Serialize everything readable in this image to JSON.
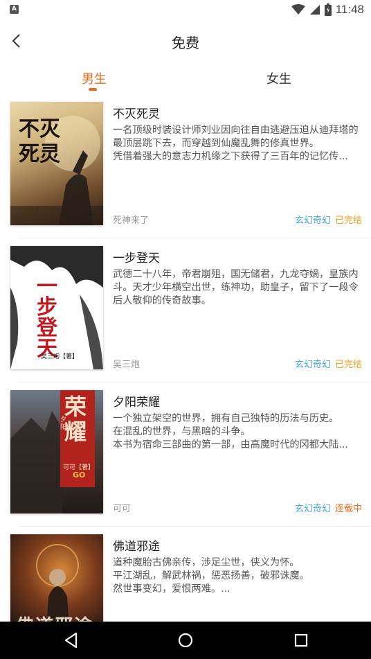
{
  "status_bar": {
    "notification_icon": "A",
    "time": "11:48",
    "icons": [
      "wifi-icon",
      "signal-icon",
      "battery-icon"
    ]
  },
  "header": {
    "title": "免费",
    "back_icon": "chevron-left-icon"
  },
  "tabs": [
    {
      "label": "男生",
      "active": true
    },
    {
      "label": "女生",
      "active": false
    }
  ],
  "colors": {
    "accent": "#f06a1b",
    "genre": "#4aa8e0",
    "completed": "#f0a020",
    "ongoing": "#f06a1b"
  },
  "books": [
    {
      "title": "不灭死灵",
      "description": "一名顶级时装设计师刘业因向往自由逃避压迫从迪拜塔的最顶层跳下去，而穿越到仙魔乱舞的修真世界。\n凭借着强大的意志力机缘之下获得了三百年的记忆传...",
      "author": "死神来了",
      "genre": "玄幻奇幻",
      "status": "已完结",
      "cover_text": "不灭死灵"
    },
    {
      "title": "一步登天",
      "description": "武德二十八年，帝君崩殂，国无储君，九龙夺嫡，皇族内斗。天才少年横空出世，练神功，助皇子，留下了一段令后人敬仰的传奇故事。",
      "author": "吴三炮",
      "genre": "玄幻奇幻",
      "status": "已完结",
      "cover_text": "一步登天",
      "cover_sub": "吴三炮【著】"
    },
    {
      "title": "夕阳荣耀",
      "description": "一个独立架空的世界，拥有自己独特的历法与历史。\n在混乱的世界，与黑暗的斗争。\n本书为宿命三部曲的第一部，由高魔时代的冈都大陆...",
      "author": "可可",
      "genre": "玄幻奇幻",
      "status": "连载中",
      "cover_text": "荣耀",
      "cover_side": "夕阳",
      "cover_sub": "可可【著】",
      "cover_go": "GO"
    },
    {
      "title": "佛道邪途",
      "description": "道种魔胎古佛亲传，涉足尘世，侠义为怀。\n平江湖乱，解武林祸，惩恶扬善，破邪诛魔。\n然世事变幻，爱恨两难。...",
      "author": "",
      "genre": "",
      "status": "",
      "cover_text": "佛道邪途"
    }
  ],
  "nav_bar": {
    "buttons": [
      "back-triangle-icon",
      "home-circle-icon",
      "recents-square-icon"
    ]
  }
}
